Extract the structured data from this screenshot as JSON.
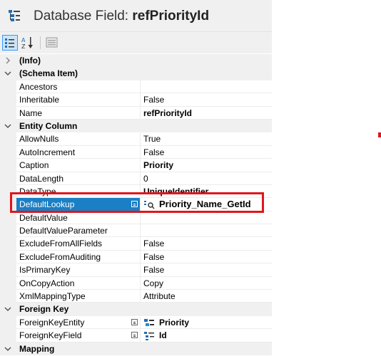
{
  "title": {
    "label": "Database Field:",
    "name": "refPriorityId"
  },
  "toolbar": {
    "categorized": "categorized-icon",
    "alphabetical": "sort-az-icon",
    "pages": "property-pages-icon"
  },
  "rows": [
    {
      "type": "cat",
      "label": "(Info)",
      "expanded": false
    },
    {
      "type": "cat",
      "label": "(Schema Item)",
      "expanded": true
    },
    {
      "type": "prop",
      "name": "Ancestors",
      "value": ""
    },
    {
      "type": "prop",
      "name": "Inheritable",
      "value": "False"
    },
    {
      "type": "prop",
      "name": "Name",
      "value": "refPriorityId",
      "bold": true
    },
    {
      "type": "cat",
      "label": "Entity Column",
      "expanded": true
    },
    {
      "type": "prop",
      "name": "AllowNulls",
      "value": "True"
    },
    {
      "type": "prop",
      "name": "AutoIncrement",
      "value": "False"
    },
    {
      "type": "prop",
      "name": "Caption",
      "value": "Priority",
      "bold": true
    },
    {
      "type": "prop",
      "name": "DataLength",
      "value": "0"
    },
    {
      "type": "prop",
      "name": "DataType",
      "value": "UniqueIdentifier",
      "bold": true
    },
    {
      "type": "prop",
      "name": "DefaultLookup",
      "value": "Priority_Name_GetId",
      "bold": true,
      "selected": true
    },
    {
      "type": "prop",
      "name": "DefaultValue",
      "value": ""
    },
    {
      "type": "prop",
      "name": "DefaultValueParameter",
      "value": ""
    },
    {
      "type": "prop",
      "name": "ExcludeFromAllFields",
      "value": "False"
    },
    {
      "type": "prop",
      "name": "ExcludeFromAuditing",
      "value": "False"
    },
    {
      "type": "prop",
      "name": "IsPrimaryKey",
      "value": "False"
    },
    {
      "type": "prop",
      "name": "OnCopyAction",
      "value": "Copy"
    },
    {
      "type": "prop",
      "name": "XmlMappingType",
      "value": "Attribute"
    },
    {
      "type": "cat",
      "label": "Foreign Key",
      "expanded": true
    },
    {
      "type": "prop",
      "name": "ForeignKeyEntity",
      "value": "Priority",
      "bold": true
    },
    {
      "type": "prop",
      "name": "ForeignKeyField",
      "value": "Id",
      "bold": true
    },
    {
      "type": "cat",
      "label": "Mapping",
      "expanded": true
    }
  ],
  "colors": {
    "selected": "#1a7fc4",
    "highlight": "#e0161d",
    "category": "#f0f0f0"
  }
}
